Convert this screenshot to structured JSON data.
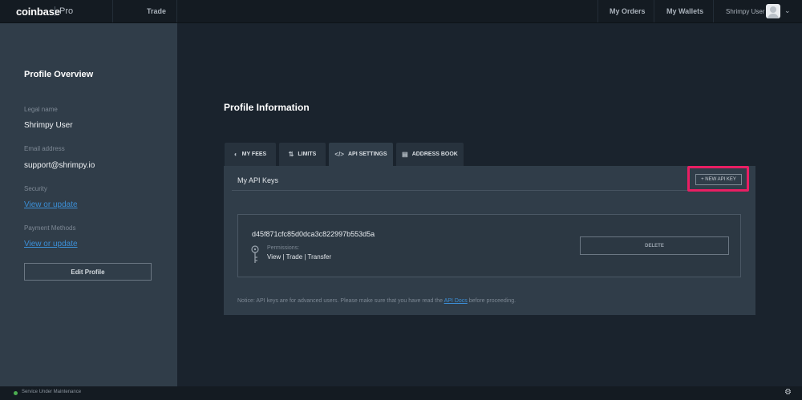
{
  "app": {
    "logo": "coinbase",
    "product": "Pro"
  },
  "topnav": {
    "trade": "Trade",
    "my_orders": "My Orders",
    "my_wallets": "My Wallets",
    "user_name": "Shrimpy User"
  },
  "sidebar": {
    "title": "Profile Overview",
    "legal_name_label": "Legal name",
    "legal_name_value": "Shrimpy User",
    "email_label": "Email address",
    "email_value": "support@shrimpy.io",
    "security_label": "Security",
    "security_link": "View or update",
    "payment_label": "Payment Methods",
    "payment_link": "View or update",
    "edit_profile": "Edit Profile"
  },
  "main": {
    "title": "Profile Information",
    "tabs": [
      {
        "label": "MY FEES",
        "icon": "fees-icon"
      },
      {
        "label": "LIMITS",
        "icon": "limits-icon"
      },
      {
        "label": "API SETTINGS",
        "icon": "code-icon"
      },
      {
        "label": "ADDRESS BOOK",
        "icon": "address-book-icon"
      }
    ],
    "active_tab": "API SETTINGS",
    "panel_title": "My API Keys",
    "new_key_button": "+ NEW API KEY",
    "api_key": {
      "hash": "d45f871cfc85d0dca3c822997b553d5a",
      "permissions_label": "Permissions:",
      "permissions_value": "View | Trade | Transfer",
      "delete_button": "DELETE"
    },
    "notice_pre": "Notice: API keys are for advanced users. Please make sure that you have read the ",
    "notice_link": "API Docs",
    "notice_post": " before proceeding."
  },
  "footer": {
    "status": "Service Under Maintenance",
    "status_color": "#4caf50"
  },
  "colors": {
    "highlight": "#e91e63",
    "link": "#3c8fd6",
    "sidebar_bg": "#303d49",
    "page_bg": "#1a232d"
  }
}
